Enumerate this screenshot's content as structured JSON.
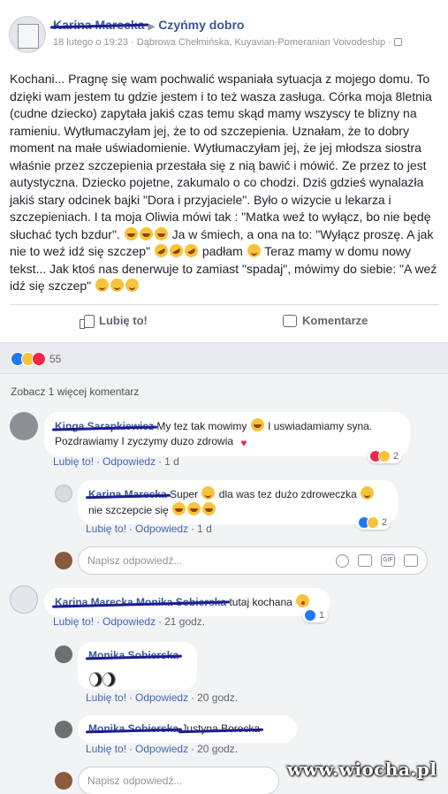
{
  "post": {
    "author": "Karina Marecka",
    "group": "Czyńmy dobro",
    "date": "18 lutego o 19:23",
    "location": "Dąbrowa Chełmińska, Kuyavian-Pomeranian Voivodeship",
    "text_1": "Kochani... Pragnę się wam pochwalić wspaniała sytuacja z mojego domu. To dzięki wam jestem tu gdzie jestem i to też wasza zasługa. Córka moja 8letnia (cudne dziecko) zapytała jakiś czas temu skąd mamy wszyscy te blizny na ramieniu. Wytłumaczyłam jej, że to od szczepienia. Uznałam, że to dobry moment na małe uświadomienie. Wytłumaczyłam jej, że jej młodsza siostra właśnie przez szczepienia przestała się z nią bawić i mówić. Ze przez to jest autystyczna. Dziecko pojetne, zakumalo o co chodzi. Dziś gdzieś wynalazła jakiś stary odcinek bajki \"Dora i przyjaciele\". Było o wizycie u lekarza i szczepieniach. I ta moja Oliwia mówi tak : \"Matka weź to wyłącz, bo nie będę słuchać tych bzdur\".",
    "text_2": "Ja w śmiech, a ona na to: \"Wyłącz proszę. A jak nie to weź idź się szczep\"",
    "text_3": "padłam",
    "text_4": "Teraz mamy w domu nowy tekst... Jak ktoś nas denerwuje to zamiast \"spadaj\", mówimy do siebie: \"A weź idź się szczep\"",
    "like_label": "Lubię to!",
    "comment_label": "Komentarze",
    "reaction_count": "55"
  },
  "comments": {
    "see_more": "Zobacz 1 więcej komentarz",
    "like_link": "Lubię to!",
    "reply_link": "Odpowiedz",
    "reply_placeholder": "Napisz odpowiedź...",
    "c1": {
      "name": "Kinga Sarapkiewicz",
      "text_a": "My tez tak mowimy",
      "text_b": "I uswiadamiamy syna. Pozdrawiamy I zyczymy duzo zdrowia",
      "time": "1 d",
      "reactions": "2"
    },
    "c1r1": {
      "name": "Karina Marecka",
      "text_a": "Super",
      "text_b": "dla was tez dużo zdroweczka",
      "text_c": "nie szczepcie się",
      "time": "1 d",
      "reactions": "2"
    },
    "c2": {
      "name": "Karina Marecka Monika Sobierska",
      "text_a": "tutaj kochana",
      "time": "21 godz.",
      "reactions": "1"
    },
    "c2r1": {
      "name": "Monika Sobierska",
      "time": "20 godz."
    },
    "c2r2": {
      "name": "Monika Sobierska",
      "text_a": "Justyna Borecka",
      "time": "20 godz."
    }
  },
  "watermark": "www.wiocha.pl",
  "colors": {
    "link": "#385898",
    "redaction": "#1d1d8f",
    "like": "#2078f4"
  }
}
